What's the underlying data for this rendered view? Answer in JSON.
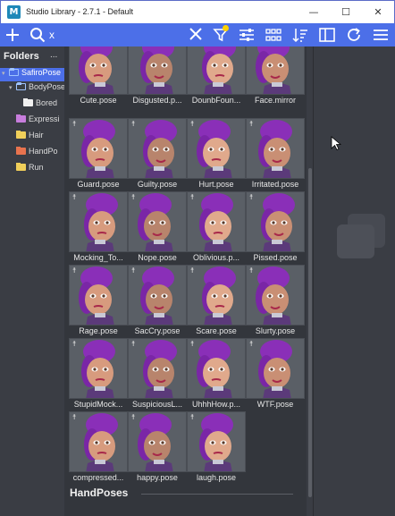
{
  "window": {
    "title": "Studio Library - 2.7.1 - Default",
    "minimize": "—",
    "maximize": "☐",
    "close": "✕"
  },
  "toolbar": {
    "search_value": "x",
    "icons": [
      "plus-icon",
      "search-icon",
      "clear-icon",
      "filter-icon",
      "settings-sliders-icon",
      "grid-view-icon",
      "sort-icon",
      "columns-icon",
      "refresh-icon",
      "menu-icon"
    ],
    "accent_color": "#4c6fe8",
    "filter_indicator_color": "#ffd200"
  },
  "folders": {
    "header": "Folders",
    "menu": "...",
    "items": [
      {
        "label": "SafiroPose",
        "level": 0,
        "expanded": true,
        "selected": true,
        "color": "#9fc4ff",
        "outline": true
      },
      {
        "label": "BodyPose",
        "level": 1,
        "expanded": true,
        "selected": false,
        "color": "#9fc4ff",
        "outline": true
      },
      {
        "label": "Bored",
        "level": 2,
        "selected": false,
        "color": "#f0f0f0"
      },
      {
        "label": "Expressi",
        "level": 1,
        "selected": false,
        "color": "#c77ddc"
      },
      {
        "label": "Hair",
        "level": 1,
        "selected": false,
        "color": "#f0cf5a"
      },
      {
        "label": "HandPo",
        "level": 1,
        "selected": false,
        "color": "#e8734e"
      },
      {
        "label": "Run",
        "level": 1,
        "selected": false,
        "color": "#f0cf5a"
      }
    ]
  },
  "items": [
    {
      "label": "Cute.pose",
      "icon": "person"
    },
    {
      "label": "Disgusted.p...",
      "icon": "person"
    },
    {
      "label": "DounbFoun...",
      "icon": "person"
    },
    {
      "label": "Face.mirror",
      "icon": "warning"
    },
    {
      "label": "Guard.pose",
      "icon": "person"
    },
    {
      "label": "Guilty.pose",
      "icon": "person"
    },
    {
      "label": "Hurt.pose",
      "icon": "person"
    },
    {
      "label": "Irritated.pose",
      "icon": "person"
    },
    {
      "label": "Mocking_To...",
      "icon": "person"
    },
    {
      "label": "Nope.pose",
      "icon": "person"
    },
    {
      "label": "Oblivious.p...",
      "icon": "person"
    },
    {
      "label": "Pissed.pose",
      "icon": "person"
    },
    {
      "label": "Rage.pose",
      "icon": "person"
    },
    {
      "label": "SacCry.pose",
      "icon": "person"
    },
    {
      "label": "Scare.pose",
      "icon": "person"
    },
    {
      "label": "Slurty.pose",
      "icon": "person"
    },
    {
      "label": "StupidMock...",
      "icon": "person"
    },
    {
      "label": "SuspiciousL...",
      "icon": "person"
    },
    {
      "label": "UhhhHow.p...",
      "icon": "person"
    },
    {
      "label": "WTF.pose",
      "icon": "person"
    },
    {
      "label": "compressed...",
      "icon": "person"
    },
    {
      "label": "happy.pose",
      "icon": "person"
    },
    {
      "label": "laugh.pose",
      "icon": "person"
    }
  ],
  "group_heading": "HandPoses"
}
